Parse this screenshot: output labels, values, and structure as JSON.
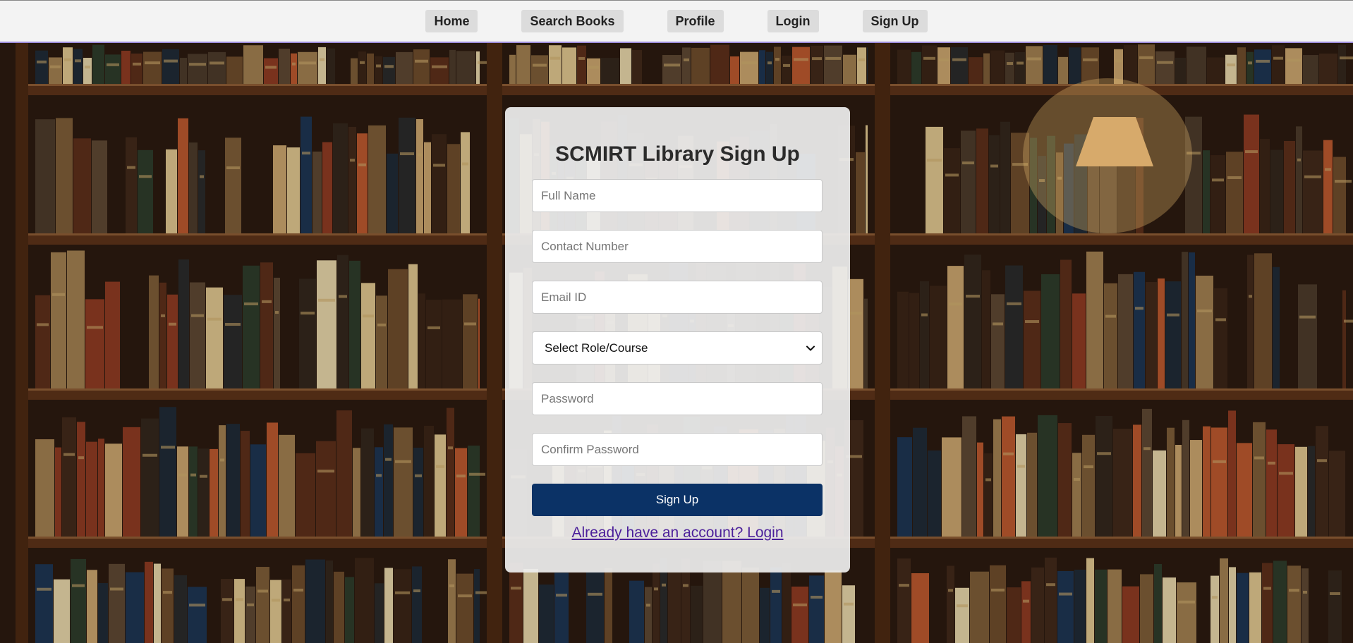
{
  "nav": {
    "items": [
      {
        "label": "Home"
      },
      {
        "label": "Search Books"
      },
      {
        "label": "Profile"
      },
      {
        "label": "Login"
      },
      {
        "label": "Sign Up"
      }
    ]
  },
  "form": {
    "title": "SCMIRT Library Sign Up",
    "full_name_placeholder": "Full Name",
    "contact_placeholder": "Contact Number",
    "email_placeholder": "Email ID",
    "role_selected": "Select Role/Course",
    "password_placeholder": "Password",
    "confirm_password_placeholder": "Confirm Password",
    "submit_label": "Sign Up",
    "login_link_label": "Already have an account? Login"
  },
  "colors": {
    "submit_button": "#0b3266",
    "link": "#4b1f9a",
    "nav_bar": "#f3f3f3",
    "nav_button": "#dcdcdc"
  },
  "icons": {
    "select_arrow": "chevron-down-icon"
  }
}
